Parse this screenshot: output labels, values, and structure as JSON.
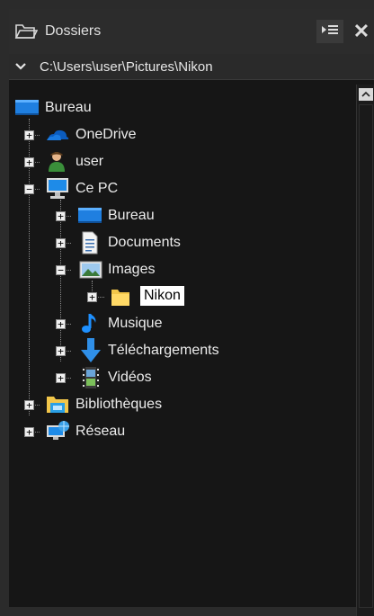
{
  "panel": {
    "title": "Dossiers"
  },
  "header": {
    "pin_icon": "pin-list-icon",
    "close_label": "✕",
    "close_icon": "close-icon"
  },
  "pathbar": {
    "path": "C:\\Users\\user\\Pictures\\Nikon",
    "chevron": "chevron-down-icon"
  },
  "tree": {
    "items": [
      {
        "label": "Bureau",
        "icon": "desktop-icon",
        "level": 0,
        "expander": ""
      },
      {
        "label": "OneDrive",
        "icon": "cloud-icon",
        "level": 1,
        "expander": "+"
      },
      {
        "label": "user",
        "icon": "user-icon",
        "level": 1,
        "expander": "+"
      },
      {
        "label": "Ce PC",
        "icon": "computer-icon",
        "level": 1,
        "expander": "−"
      },
      {
        "label": "Bureau",
        "icon": "desktop-icon",
        "level": 2,
        "expander": "+"
      },
      {
        "label": "Documents",
        "icon": "document-icon",
        "level": 2,
        "expander": "+"
      },
      {
        "label": "Images",
        "icon": "image-icon",
        "level": 2,
        "expander": "−"
      },
      {
        "label": "Nikon",
        "icon": "folder-icon",
        "level": 3,
        "expander": "+",
        "selected": true
      },
      {
        "label": "Musique",
        "icon": "music-icon",
        "level": 2,
        "expander": "+"
      },
      {
        "label": "Téléchargements",
        "icon": "download-icon",
        "level": 2,
        "expander": "+"
      },
      {
        "label": "Vidéos",
        "icon": "video-icon",
        "level": 2,
        "expander": "+"
      },
      {
        "label": "Bibliothèques",
        "icon": "library-icon",
        "level": 1,
        "expander": "+"
      },
      {
        "label": "Réseau",
        "icon": "network-icon",
        "level": 1,
        "expander": "+"
      }
    ]
  }
}
